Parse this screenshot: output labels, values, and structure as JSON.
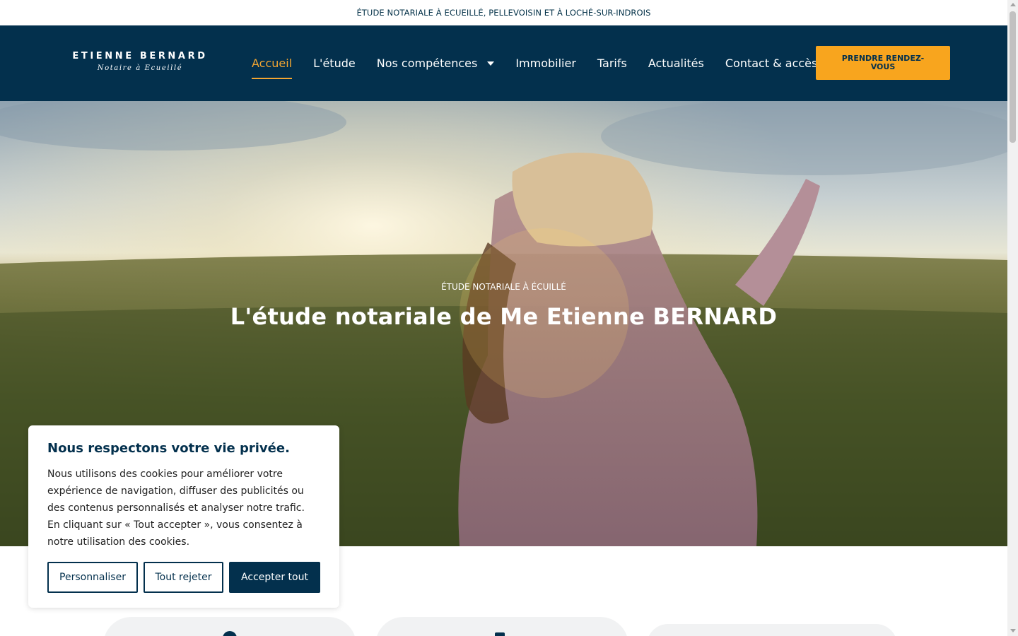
{
  "topbar": {
    "text": "ÉTUDE NOTARIALE À ECUEILLÉ, PELLEVOISIN ET À LOCHÉ-SUR-INDROIS"
  },
  "header": {
    "logo_name": "ETIENNE BERNARD",
    "logo_subtitle": "Notaire à Ecueillé",
    "nav": [
      {
        "label": "Accueil",
        "active": true
      },
      {
        "label": "L'étude"
      },
      {
        "label": "Nos compétences",
        "has_dropdown": true
      },
      {
        "label": "Immobilier"
      },
      {
        "label": "Tarifs"
      },
      {
        "label": "Actualités"
      },
      {
        "label": "Contact & accès"
      }
    ],
    "cta_label": "PRENDRE RENDEZ-VOUS"
  },
  "hero": {
    "eyebrow": "ÉTUDE NOTARIALE À ÉCUILLÉ",
    "title": "L'étude notariale de Me Etienne BERNARD"
  },
  "cookie_banner": {
    "title": "Nous respectons votre vie privée.",
    "text": "Nous utilisons des cookies pour améliorer votre expérience de navigation, diffuser des publicités ou des contenus personnalisés et analyser notre trafic. En cliquant sur « Tout accepter », vous consentez à notre utilisation des cookies.",
    "buttons": {
      "customize": "Personnaliser",
      "reject": "Tout rejeter",
      "accept": "Accepter tout"
    }
  },
  "colors": {
    "navy": "#03304d",
    "accent": "#f8a51e",
    "active_nav": "#f3a632"
  }
}
